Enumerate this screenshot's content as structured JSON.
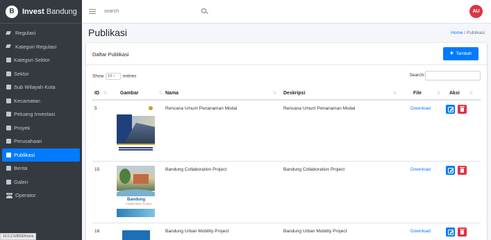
{
  "app": {
    "brand_short": "B",
    "brand_bold": "Invest",
    "brand_rest": " Bandung"
  },
  "sidebar": {
    "items": [
      {
        "label": "Regulasi",
        "icon": "paint-icon"
      },
      {
        "label": "Kategori Regulasi",
        "icon": "paint-icon"
      },
      {
        "label": "Kategori Sektor",
        "icon": "square-icon"
      },
      {
        "label": "Sektor",
        "icon": "square-icon"
      },
      {
        "label": "Sub Wilayah Kota",
        "icon": "square-icon"
      },
      {
        "label": "Kecamatan",
        "icon": "square-icon"
      },
      {
        "label": "Peluang Investasi",
        "icon": "square-icon"
      },
      {
        "label": "Proyek",
        "icon": "square-icon"
      },
      {
        "label": "Perusahaan",
        "icon": "square-icon"
      },
      {
        "label": "Publikasi",
        "icon": "square-icon",
        "active": true
      },
      {
        "label": "Berita",
        "icon": "square-icon"
      },
      {
        "label": "Galeri",
        "icon": "square-icon"
      },
      {
        "label": "Operator",
        "icon": "users-icon"
      }
    ],
    "status_url": "10.0.2.5/8000/home"
  },
  "navbar": {
    "search_placeholder": "search",
    "avatar": "AU"
  },
  "header": {
    "title": "Publikasi",
    "breadcrumb_home": "Home",
    "breadcrumb_sep": " / ",
    "breadcrumb_current": "Publikasi"
  },
  "card": {
    "title": "Daftar Publikasi",
    "add_label": "Tambah",
    "show_label": "Show",
    "length_value": "10 ↕",
    "entries_label": "entries",
    "search_label": "Search:"
  },
  "table": {
    "columns": {
      "id": "ID",
      "gambar": "Gambar",
      "nama": "Nama",
      "deskripsi": "Deskripsi",
      "file": "File",
      "aksi": "Aksi"
    },
    "rows": [
      {
        "id": "5",
        "nama": "Rencana Umum Penanaman Modal",
        "deskripsi": "Rencana Umum Penanaman Modal",
        "file": "Download"
      },
      {
        "id": "15",
        "nama": "Bandung Collaboration Project",
        "deskripsi": "Bandung Collaboration Project",
        "file": "Download",
        "thumb_title": "Bandung",
        "thumb_subtitle": "Collaboration Project"
      },
      {
        "id": "16",
        "nama": "Bandung Urban Mobility Project",
        "deskripsi": "Bandung Urban Mobility Project",
        "file": "Download"
      }
    ]
  },
  "colors": {
    "primary": "#007bff",
    "danger": "#dc3545",
    "sidebar_bg": "#343a40"
  }
}
